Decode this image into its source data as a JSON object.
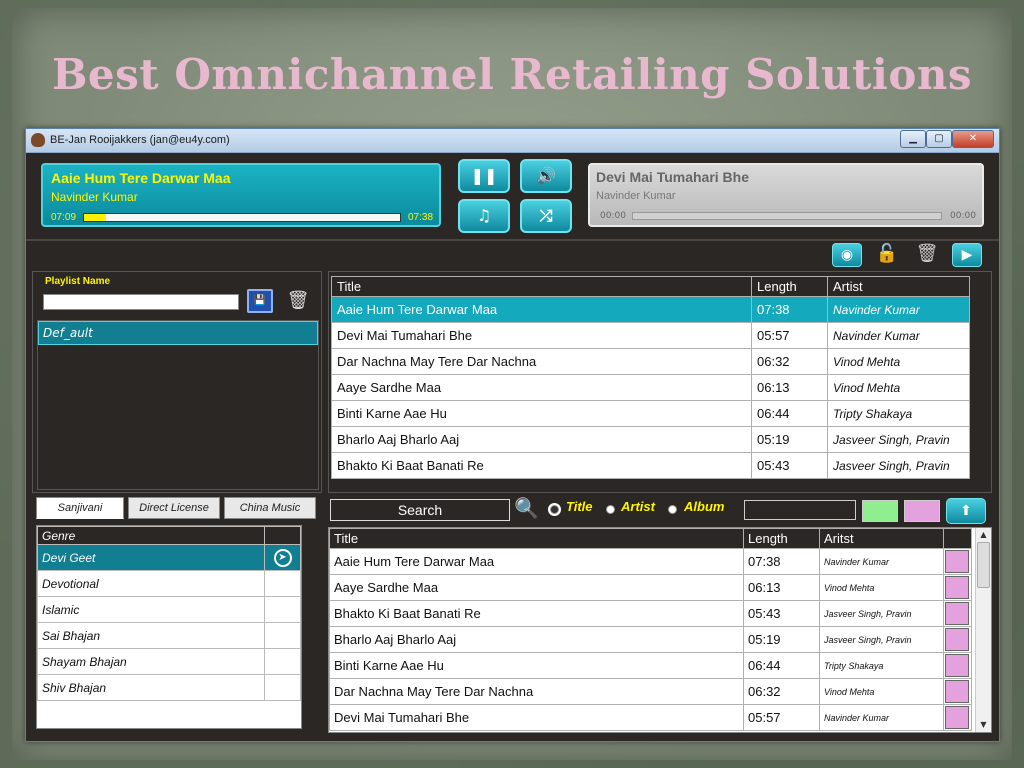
{
  "slide": {
    "title": "Best Omnichannel Retailing Solutions"
  },
  "window": {
    "title": "BE-Jan Rooijakkers (jan@eu4y.com)"
  },
  "now_playing": {
    "title": "Aaie Hum Tere Darwar Maa",
    "artist": "Navinder Kumar",
    "elapsed": "07:09",
    "total": "07:38",
    "progress": 0.07
  },
  "controls": {
    "pause": "❚❚",
    "volume": "🔊",
    "music": "♫",
    "shuffle": "⤮"
  },
  "up_next": {
    "title": "Devi Mai Tumahari Bhe",
    "artist": "Navinder Kumar",
    "elapsed": "00:00",
    "total": "00:00"
  },
  "playlist": {
    "label": "Playlist Name",
    "input_value": "",
    "items": [
      {
        "label": "Def_ault"
      }
    ]
  },
  "tracks": {
    "headers": {
      "title": "Title",
      "length": "Length",
      "artist": "Artist"
    },
    "rows": [
      {
        "title": "Aaie Hum Tere Darwar Maa",
        "length": "07:38",
        "artist": "Navinder Kumar"
      },
      {
        "title": "Devi Mai Tumahari Bhe",
        "length": "05:57",
        "artist": "Navinder Kumar"
      },
      {
        "title": "Dar Nachna May Tere Dar Nachna",
        "length": "06:32",
        "artist": "Vinod Mehta"
      },
      {
        "title": "Aaye Sardhe Maa",
        "length": "06:13",
        "artist": "Vinod Mehta"
      },
      {
        "title": "Binti Karne Aae Hu",
        "length": "06:44",
        "artist": "Tripty Shakaya"
      },
      {
        "title": "Bharlo Aaj Bharlo Aaj",
        "length": "05:19",
        "artist": "Jasveer Singh, Pravin"
      },
      {
        "title": "Bhakto Ki Baat Banati Re",
        "length": "05:43",
        "artist": "Jasveer Singh, Pravin"
      }
    ]
  },
  "library_tabs": [
    {
      "label": "Sanjivani"
    },
    {
      "label": "Direct License"
    },
    {
      "label": "China Music"
    }
  ],
  "genres": {
    "header": "Genre",
    "items": [
      {
        "label": "Devi Geet"
      },
      {
        "label": "Devotional"
      },
      {
        "label": "Islamic"
      },
      {
        "label": "Sai Bhajan"
      },
      {
        "label": "Shayam Bhajan"
      },
      {
        "label": "Shiv Bhajan"
      }
    ]
  },
  "search": {
    "button_label": "Search",
    "options": {
      "title": "Title",
      "artist": "Artist",
      "album": "Album"
    },
    "selected": "title",
    "query": "",
    "swatch_colors": [
      "#90ee90",
      "#e3a1dd"
    ]
  },
  "results": {
    "headers": {
      "title": "Title",
      "length": "Length",
      "artist": "Aritst"
    },
    "rows": [
      {
        "title": "Aaie Hum Tere Darwar Maa",
        "length": "07:38",
        "artist": "Navinder Kumar"
      },
      {
        "title": "Aaye Sardhe Maa",
        "length": "06:13",
        "artist": "Vinod Mehta"
      },
      {
        "title": "Bhakto Ki Baat Banati Re",
        "length": "05:43",
        "artist": "Jasveer Singh, Pravin"
      },
      {
        "title": "Bharlo Aaj Bharlo Aaj",
        "length": "05:19",
        "artist": "Jasveer Singh, Pravin"
      },
      {
        "title": "Binti Karne Aae Hu",
        "length": "06:44",
        "artist": "Tripty Shakaya"
      },
      {
        "title": "Dar Nachna May Tere Dar Nachna",
        "length": "06:32",
        "artist": "Vinod Mehta"
      },
      {
        "title": "Devi Mai Tumahari Bhe",
        "length": "05:57",
        "artist": "Navinder Kumar"
      }
    ]
  },
  "colors": {
    "accent": "#14a9bd",
    "highlight_text": "#fff500",
    "panel_bg": "#2b2724",
    "title_pink": "#e8b8cf"
  }
}
